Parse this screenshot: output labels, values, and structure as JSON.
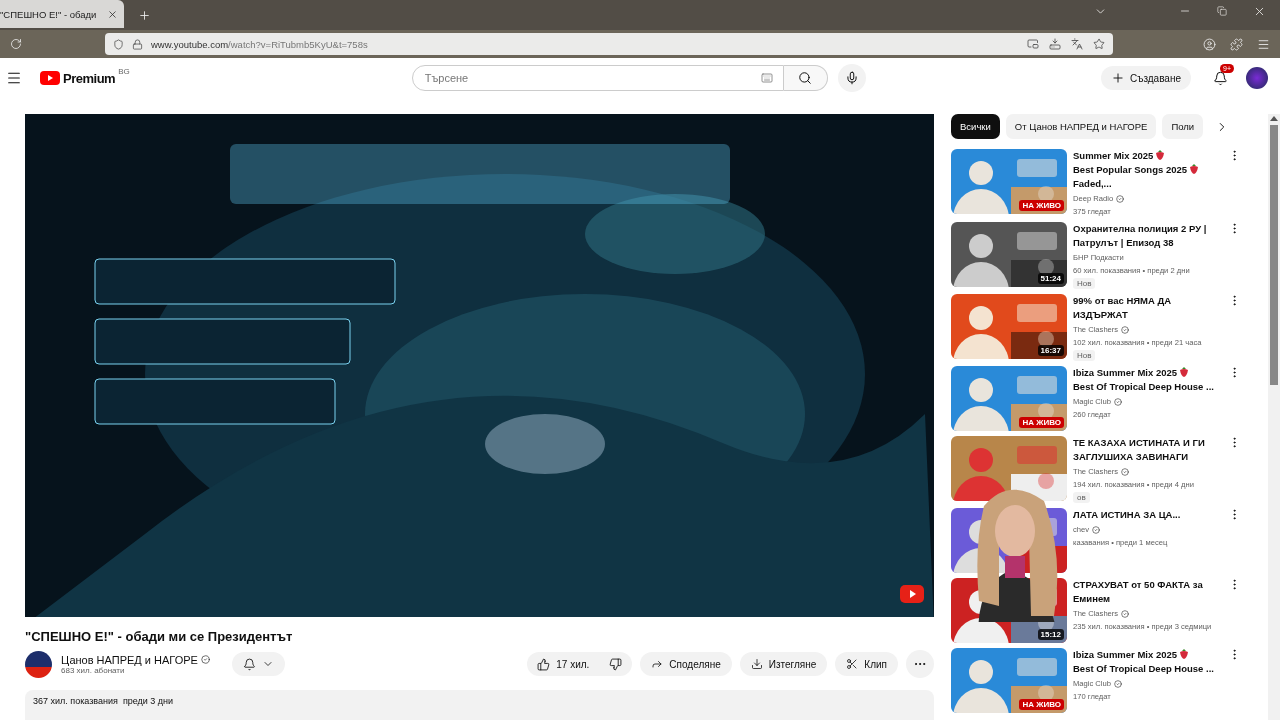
{
  "browser": {
    "tab_title": "\"СПЕШНО Е!\" - обади",
    "url_host": "www.youtube.com",
    "url_path": "/watch?v=RiTubmb5KyU&t=758s"
  },
  "header": {
    "logo": "Premium",
    "region": "BG",
    "search": {
      "placeholder": "Търсене"
    },
    "create": "Създаване",
    "notifications": "9+"
  },
  "video": {
    "kind": "picture",
    "title": "\"СПЕШНО Е!\" - обади ми се Президентът",
    "channel": "Цанов НАПРЕД и НАГОРЕ",
    "channel_verified": true,
    "subscribers": "683 хил. абонати",
    "likes": "17 хил.",
    "actions": [
      "Споделяне",
      "Изтегляне",
      "Клип"
    ],
    "description": "367 хил. показвания  преди 3 дни"
  },
  "chips": [
    {
      "label": "Всички",
      "selected": true
    },
    {
      "label": "От Цанов НАПРЕД и НАГОРЕ",
      "selected": false
    },
    {
      "label": "Поли",
      "selected": false
    }
  ],
  "recommendations": [
    {
      "title_parts": [
        "Summer Mix 2025",
        "Best Popular Songs 2025",
        "Faded,..."
      ],
      "channel": "Deep Radio",
      "verified": true,
      "meta": "375 гледат",
      "badge": {
        "kind": "live",
        "text": "НА ЖИВО"
      }
    },
    {
      "title_parts": [
        "Охранителна полиция 2 РУ | Патрулът | Епизод 38"
      ],
      "channel": "БНР Подкасти",
      "verified": false,
      "meta": "60 хил. показвания • преди 2 дни",
      "badge": {
        "kind": "duration",
        "text": "51:24"
      },
      "tag": "Нов"
    },
    {
      "title_parts": [
        "99% от вас НЯМА ДА ИЗДЪРЖАТ"
      ],
      "channel": "The Clashers",
      "verified": true,
      "meta": "102 хил. показвания • преди 21 часа",
      "badge": {
        "kind": "duration",
        "text": "16:37"
      },
      "tag": "Нов"
    },
    {
      "title_parts": [
        "Ibiza Summer Mix 2025",
        "Best Of Tropical Deep House ..."
      ],
      "channel": "Magic Club",
      "verified": true,
      "meta": "260 гледат",
      "badge": {
        "kind": "live",
        "text": "НА ЖИВО"
      }
    },
    {
      "title_parts": [
        "ТЕ КАЗАХА ИСТИНАТА И ГИ ЗАГЛУШИХА ЗАВИНАГИ"
      ],
      "channel": "The Clashers",
      "verified": true,
      "meta": "194 хил. показвания • преди 4 дни",
      "tag": "ов"
    },
    {
      "title_parts": [
        "ЛАТА ИСТИНА ЗА ЦА..."
      ],
      "channel": "chev",
      "verified": true,
      "meta": "казавания • преди 1 месец"
    },
    {
      "title_parts": [
        "СТРАХУВАТ от 50 ФАКТА за Еминем"
      ],
      "channel": "The Clashers",
      "verified": true,
      "meta": "235 хил. показвания • преди 3 седмици",
      "badge": {
        "kind": "duration",
        "text": "15:12"
      }
    },
    {
      "title_parts": [
        "Ibiza Summer Mix 2025",
        "Best Of Tropical Deep House ..."
      ],
      "channel": "Magic Club",
      "verified": true,
      "meta": "170 гледат",
      "badge": {
        "kind": "live",
        "text": "НА ЖИВО"
      }
    }
  ]
}
